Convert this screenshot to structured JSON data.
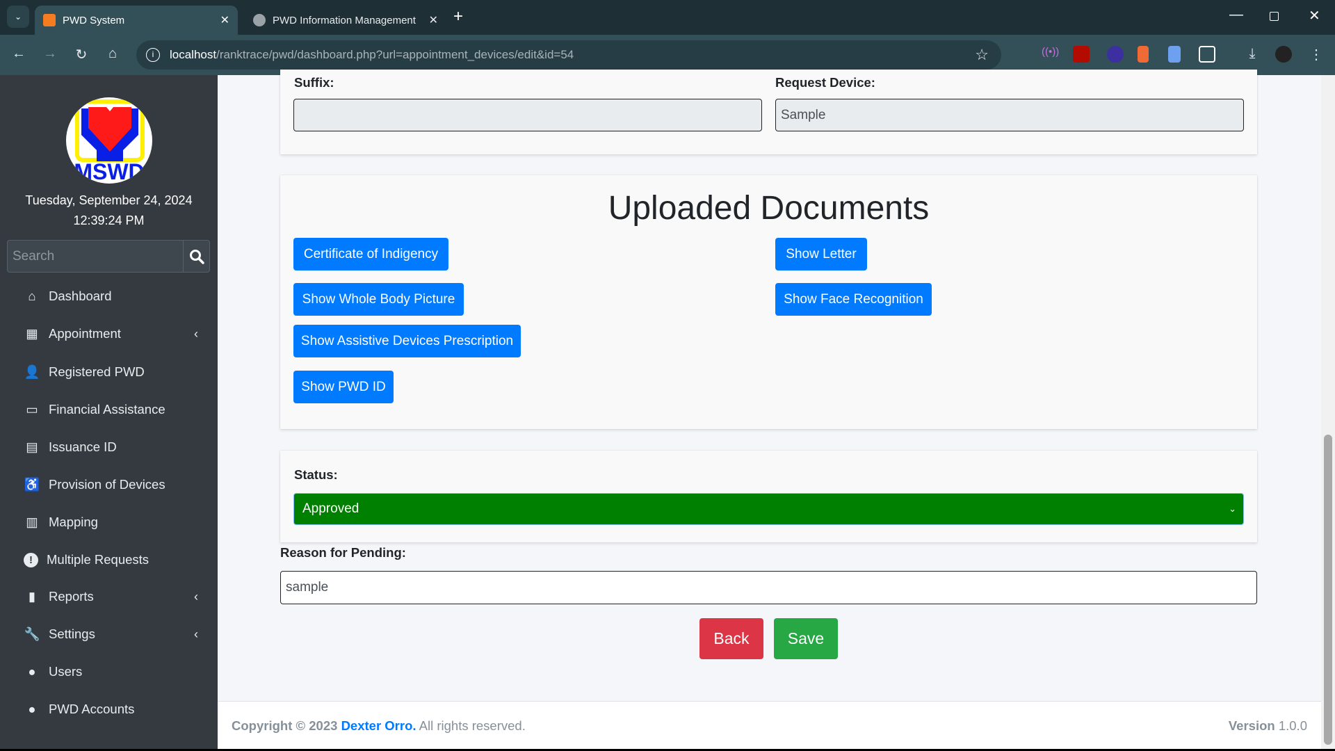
{
  "browser": {
    "tabs": [
      {
        "title": "PWD System",
        "active": true
      },
      {
        "title": "PWD Information Management",
        "active": false
      }
    ],
    "url_host": "localhost",
    "url_path": "/ranktrace/pwd/dashboard.php?url=appointment_devices/edit&id=54"
  },
  "sidebar": {
    "logo_text": "MSWD",
    "date": "Tuesday, September 24, 2024",
    "time": "12:39:24 PM",
    "search_placeholder": "Search",
    "items": [
      {
        "label": "Dashboard",
        "icon": "home-icon"
      },
      {
        "label": "Appointment",
        "icon": "calendar-icon",
        "chevron": true
      },
      {
        "label": "Registered PWD",
        "icon": "user-plus-icon"
      },
      {
        "label": "Financial Assistance",
        "icon": "money-icon"
      },
      {
        "label": "Issuance ID",
        "icon": "id-card-icon"
      },
      {
        "label": "Provision of Devices",
        "icon": "wheelchair-icon"
      },
      {
        "label": "Mapping",
        "icon": "map-icon"
      },
      {
        "label": "Multiple Requests",
        "icon": "exclamation-icon"
      },
      {
        "label": "Reports",
        "icon": "book-icon",
        "chevron": true
      },
      {
        "label": "Settings",
        "icon": "wrench-icon",
        "chevron": true
      },
      {
        "label": "Users",
        "icon": "user-icon"
      },
      {
        "label": "PWD Accounts",
        "icon": "user-icon"
      }
    ]
  },
  "form": {
    "suffix_label": "Suffix:",
    "suffix_value": "",
    "request_device_label": "Request Device:",
    "request_device_value": "Sample",
    "documents_title": "Uploaded Documents",
    "documents": {
      "certificate": "Certificate of Indigency",
      "letter": "Show Letter",
      "whole_body": "Show Whole Body Picture",
      "face": "Show Face Recognition",
      "prescription": "Show Assistive Devices Prescription",
      "pwd_id": "Show PWD ID"
    },
    "status_label": "Status:",
    "status_value": "Approved",
    "status_color": "#008000",
    "reason_label": "Reason for Pending:",
    "reason_value": "sample",
    "back_label": "Back",
    "save_label": "Save"
  },
  "footer": {
    "copyright": "Copyright © 2023",
    "author": "Dexter Orro.",
    "rights": "All rights reserved.",
    "version_label": "Version",
    "version": "1.0.0"
  },
  "colors": {
    "primary": "#007bff",
    "danger": "#dc3545",
    "success": "#28a745",
    "sidebar": "#343a40"
  }
}
